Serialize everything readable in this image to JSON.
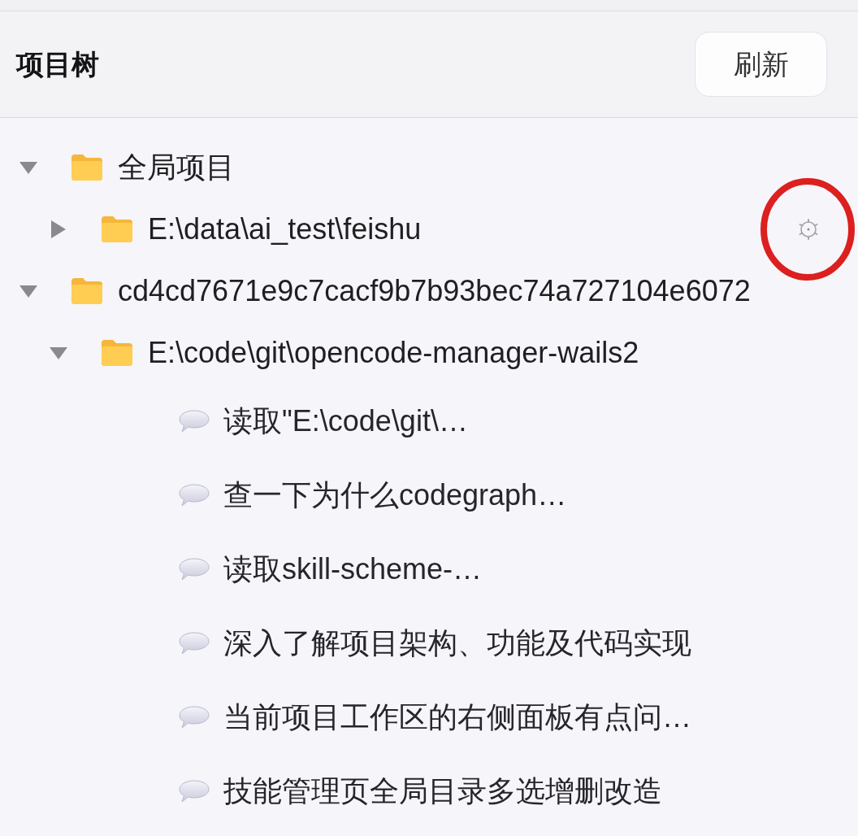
{
  "header": {
    "title": "项目树",
    "refresh_button": "刷新"
  },
  "tree": [
    {
      "kind": "folder",
      "label": "全局项目",
      "expanded": true,
      "hovered": false,
      "annotated": false,
      "children": [
        {
          "kind": "folder",
          "label": "E:\\data\\ai_test\\feishu",
          "expanded": false,
          "hovered": true,
          "annotated": true
        }
      ]
    },
    {
      "kind": "folder",
      "label": "cd4cd7671e9c7cacf9b7b93bec74a727104e6072",
      "expanded": true,
      "hovered": false,
      "annotated": false,
      "children": [
        {
          "kind": "folder",
          "label": "E:\\code\\git\\opencode-manager-wails2",
          "expanded": true,
          "hovered": false,
          "annotated": false,
          "children": [
            {
              "kind": "session",
              "label": "读取\"E:\\code\\git\\…"
            },
            {
              "kind": "session",
              "label": "查一下为什么codegraph…"
            },
            {
              "kind": "session",
              "label": "读取skill-scheme-…"
            },
            {
              "kind": "session",
              "label": "深入了解项目架构、功能及代码实现"
            },
            {
              "kind": "session",
              "label": "当前项目工作区的右侧面板有点问…"
            },
            {
              "kind": "session",
              "label": "技能管理页全局目录多选增删改造"
            }
          ]
        }
      ]
    }
  ]
}
